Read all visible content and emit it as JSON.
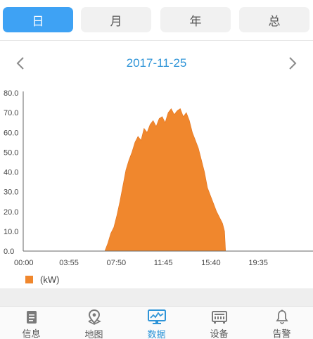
{
  "tabs": [
    {
      "label": "日",
      "active": true
    },
    {
      "label": "月",
      "active": false
    },
    {
      "label": "年",
      "active": false
    },
    {
      "label": "总",
      "active": false
    }
  ],
  "date": "2017-11-25",
  "icons": {
    "prev": "chevron-left-icon",
    "next": "chevron-right-icon"
  },
  "colors": {
    "accent": "#3ea2f4",
    "series": "#f0872d",
    "date": "#2f95d8"
  },
  "chart_data": {
    "type": "area",
    "title": "",
    "xlabel": "",
    "ylabel": "",
    "xlim": [
      "00:00",
      "23:59"
    ],
    "ylim": [
      0,
      80
    ],
    "y_ticks": [
      "0.0",
      "10.0",
      "20.0",
      "30.0",
      "40.0",
      "50.0",
      "60.0",
      "70.0",
      "80.0"
    ],
    "x_ticks": [
      "00:00",
      "03:55",
      "07:50",
      "11:45",
      "15:40",
      "19:35"
    ],
    "grid": false,
    "legend": "bottom-left",
    "series": [
      {
        "name": "(kW)",
        "color": "#f0872d",
        "x": [
          "00:00",
          "06:45",
          "07:00",
          "07:15",
          "07:30",
          "07:45",
          "08:00",
          "08:15",
          "08:30",
          "08:45",
          "09:00",
          "09:15",
          "09:30",
          "09:45",
          "10:00",
          "10:15",
          "10:30",
          "10:45",
          "11:00",
          "11:15",
          "11:30",
          "11:45",
          "12:00",
          "12:15",
          "12:30",
          "12:45",
          "13:00",
          "13:15",
          "13:30",
          "13:45",
          "14:00",
          "14:15",
          "14:30",
          "14:45",
          "15:00",
          "15:15",
          "15:30",
          "15:45",
          "16:00",
          "16:15",
          "16:30",
          "16:40",
          "16:45",
          "23:59"
        ],
        "values": [
          0,
          0,
          4,
          9,
          12,
          18,
          25,
          33,
          41,
          46,
          50,
          55,
          58,
          56,
          62,
          60,
          64,
          66,
          63,
          67,
          68,
          65,
          70,
          72,
          69,
          71,
          72,
          68,
          70,
          66,
          60,
          56,
          52,
          46,
          40,
          32,
          28,
          24,
          20,
          17,
          14,
          10,
          0,
          0
        ]
      }
    ]
  },
  "bottom_nav": [
    {
      "label": "信息",
      "icon": "document-icon",
      "active": false
    },
    {
      "label": "地图",
      "icon": "map-pin-icon",
      "active": false
    },
    {
      "label": "数据",
      "icon": "monitor-chart-icon",
      "active": true
    },
    {
      "label": "设备",
      "icon": "device-icon",
      "active": false
    },
    {
      "label": "告警",
      "icon": "bell-icon",
      "active": false
    }
  ]
}
